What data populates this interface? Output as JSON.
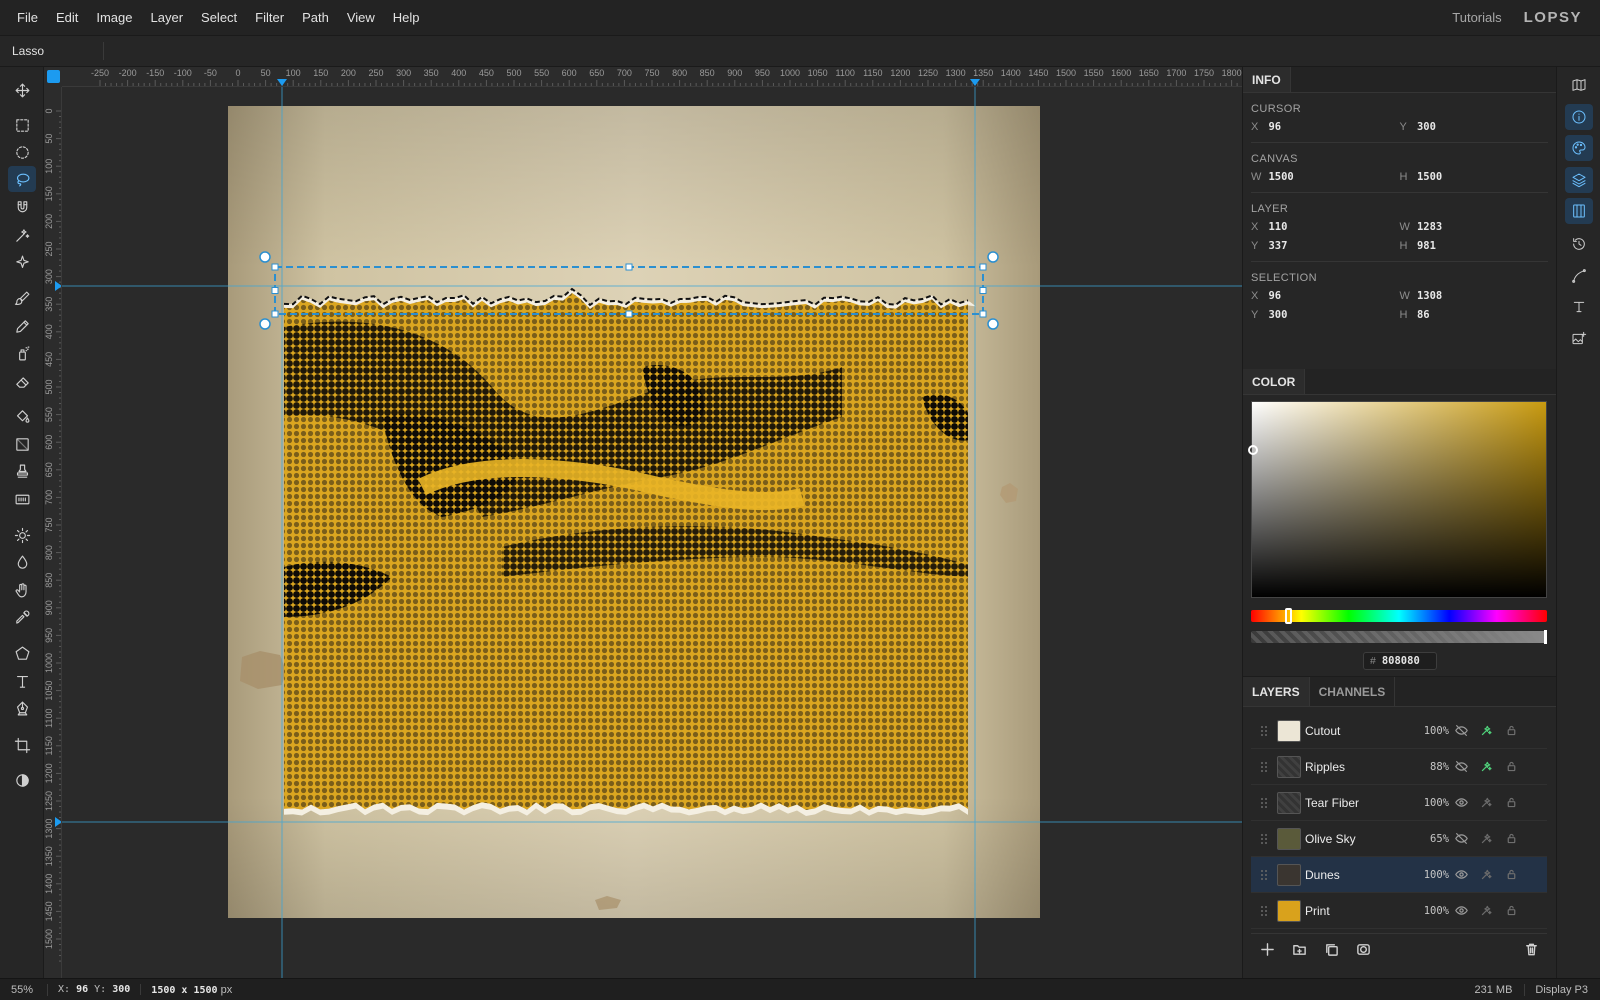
{
  "menubar": {
    "menus": [
      "File",
      "Edit",
      "Image",
      "Layer",
      "Select",
      "Filter",
      "Path",
      "View",
      "Help"
    ],
    "tutorials": "Tutorials",
    "logo": "LOPSY"
  },
  "options": {
    "tool_name": "Lasso"
  },
  "tools": [
    {
      "name": "move-tool",
      "icon": "move-icon"
    },
    {
      "name": "rect-select-tool",
      "icon": "rect-select-icon"
    },
    {
      "name": "ellipse-select-tool",
      "icon": "ellipse-select-icon"
    },
    {
      "name": "lasso-tool",
      "icon": "lasso-icon",
      "active": true
    },
    {
      "name": "magnetic-lasso-tool",
      "icon": "magnet-icon"
    },
    {
      "name": "magic-wand-tool",
      "icon": "magic-wand-icon"
    },
    {
      "name": "quick-select-tool",
      "icon": "sparkle-icon"
    },
    {
      "name": "brush-tool",
      "icon": "brush-icon"
    },
    {
      "name": "pencil-tool",
      "icon": "pencil-icon"
    },
    {
      "name": "spray-tool",
      "icon": "spray-icon"
    },
    {
      "name": "eraser-tool",
      "icon": "eraser-icon"
    },
    {
      "name": "fill-tool",
      "icon": "paint-bucket-icon"
    },
    {
      "name": "gradient-tool",
      "icon": "gradient-icon"
    },
    {
      "name": "stamp-tool",
      "icon": "stamp-icon"
    },
    {
      "name": "pattern-tool",
      "icon": "pattern-icon"
    },
    {
      "name": "dodge-tool",
      "icon": "sun-icon"
    },
    {
      "name": "blur-tool",
      "icon": "drop-icon"
    },
    {
      "name": "hand-tool",
      "icon": "hand-icon"
    },
    {
      "name": "eyedropper-tool",
      "icon": "eyedropper-icon"
    },
    {
      "name": "shape-tool",
      "icon": "pentagon-icon"
    },
    {
      "name": "text-tool",
      "icon": "text-icon"
    },
    {
      "name": "pen-tool",
      "icon": "pen-icon"
    },
    {
      "name": "crop-tool",
      "icon": "crop-icon"
    },
    {
      "name": "contrast-toggle",
      "icon": "contrast-icon"
    }
  ],
  "ruler": {
    "top_labels": [
      "-250",
      "-200",
      "-150",
      "-100",
      "-50",
      "0",
      "50",
      "100",
      "150",
      "200",
      "250",
      "300",
      "350",
      "400",
      "450",
      "500",
      "550",
      "600",
      "650",
      "700",
      "750",
      "800",
      "850",
      "900",
      "950",
      "1000",
      "1050",
      "1100",
      "1150",
      "1200",
      "1250",
      "1300",
      "1350",
      "1400",
      "1450",
      "1500",
      "1550",
      "1600",
      "1650",
      "1700",
      "1750",
      "1800"
    ],
    "left_labels": [
      "0",
      "50",
      "100",
      "150",
      "200",
      "250",
      "300",
      "350",
      "400",
      "450",
      "500",
      "550",
      "600",
      "650",
      "700",
      "750",
      "800",
      "850",
      "900",
      "950",
      "1000",
      "1050",
      "1100",
      "1150",
      "1200",
      "1250",
      "1300",
      "1350",
      "1400",
      "1450",
      "1500"
    ]
  },
  "info": {
    "tab": "INFO",
    "cursor": {
      "title": "CURSOR",
      "x": "96",
      "y": "300"
    },
    "canvas": {
      "title": "CANVAS",
      "w": "1500",
      "h": "1500"
    },
    "layer": {
      "title": "LAYER",
      "x": "110",
      "y": "337",
      "w": "1283",
      "h": "981"
    },
    "selection": {
      "title": "SELECTION",
      "x": "96",
      "y": "300",
      "w": "1308",
      "h": "86"
    },
    "labels": {
      "x": "X",
      "y": "Y",
      "w": "W",
      "h": "H"
    }
  },
  "color": {
    "tab": "COLOR",
    "hue_color": "#c89a10",
    "hash": "#",
    "hex": "808080"
  },
  "layers": {
    "tab": "LAYERS",
    "tab2": "CHANNELS",
    "items": [
      {
        "name": "Cutout",
        "opacity": "100%",
        "visible": false,
        "fx": true,
        "thumb": "#ece6d6"
      },
      {
        "name": "Ripples",
        "opacity": "88%",
        "visible": false,
        "fx": true,
        "thumb": ""
      },
      {
        "name": "Tear Fiber",
        "opacity": "100%",
        "visible": true,
        "fx": false,
        "thumb": ""
      },
      {
        "name": "Olive Sky",
        "opacity": "65%",
        "visible": false,
        "fx": false,
        "thumb": "#5a5a3a"
      },
      {
        "name": "Dunes",
        "opacity": "100%",
        "visible": true,
        "fx": false,
        "thumb": "#3a3530",
        "selected": true
      },
      {
        "name": "Print",
        "opacity": "100%",
        "visible": true,
        "fx": false,
        "thumb": "#d9a21c"
      }
    ]
  },
  "rightbar": [
    {
      "name": "map-button",
      "icon": "map-icon"
    },
    {
      "name": "info-button",
      "icon": "info-icon",
      "active": true
    },
    {
      "name": "color-button",
      "icon": "palette-icon",
      "active": true
    },
    {
      "name": "layers-button",
      "icon": "layers-icon",
      "active": true
    },
    {
      "name": "channels-button",
      "icon": "columns-icon",
      "active": true
    },
    {
      "name": "history-button",
      "icon": "history-icon"
    },
    {
      "name": "paths-button",
      "icon": "curve-icon"
    },
    {
      "name": "type-button",
      "icon": "type-icon"
    },
    {
      "name": "image-button",
      "icon": "image-add-icon"
    }
  ],
  "status": {
    "zoom": "55%",
    "x_label": "X:",
    "x": "96",
    "y_label": "Y:",
    "y": "300",
    "size": "1500 x 1500",
    "size_unit": "px",
    "memory": "231 MB",
    "profile": "Display P3"
  },
  "artwork": {
    "paper_color": "#d2c6a6",
    "ink_color": "#dba620",
    "guide_color": "#3aa5d8"
  }
}
